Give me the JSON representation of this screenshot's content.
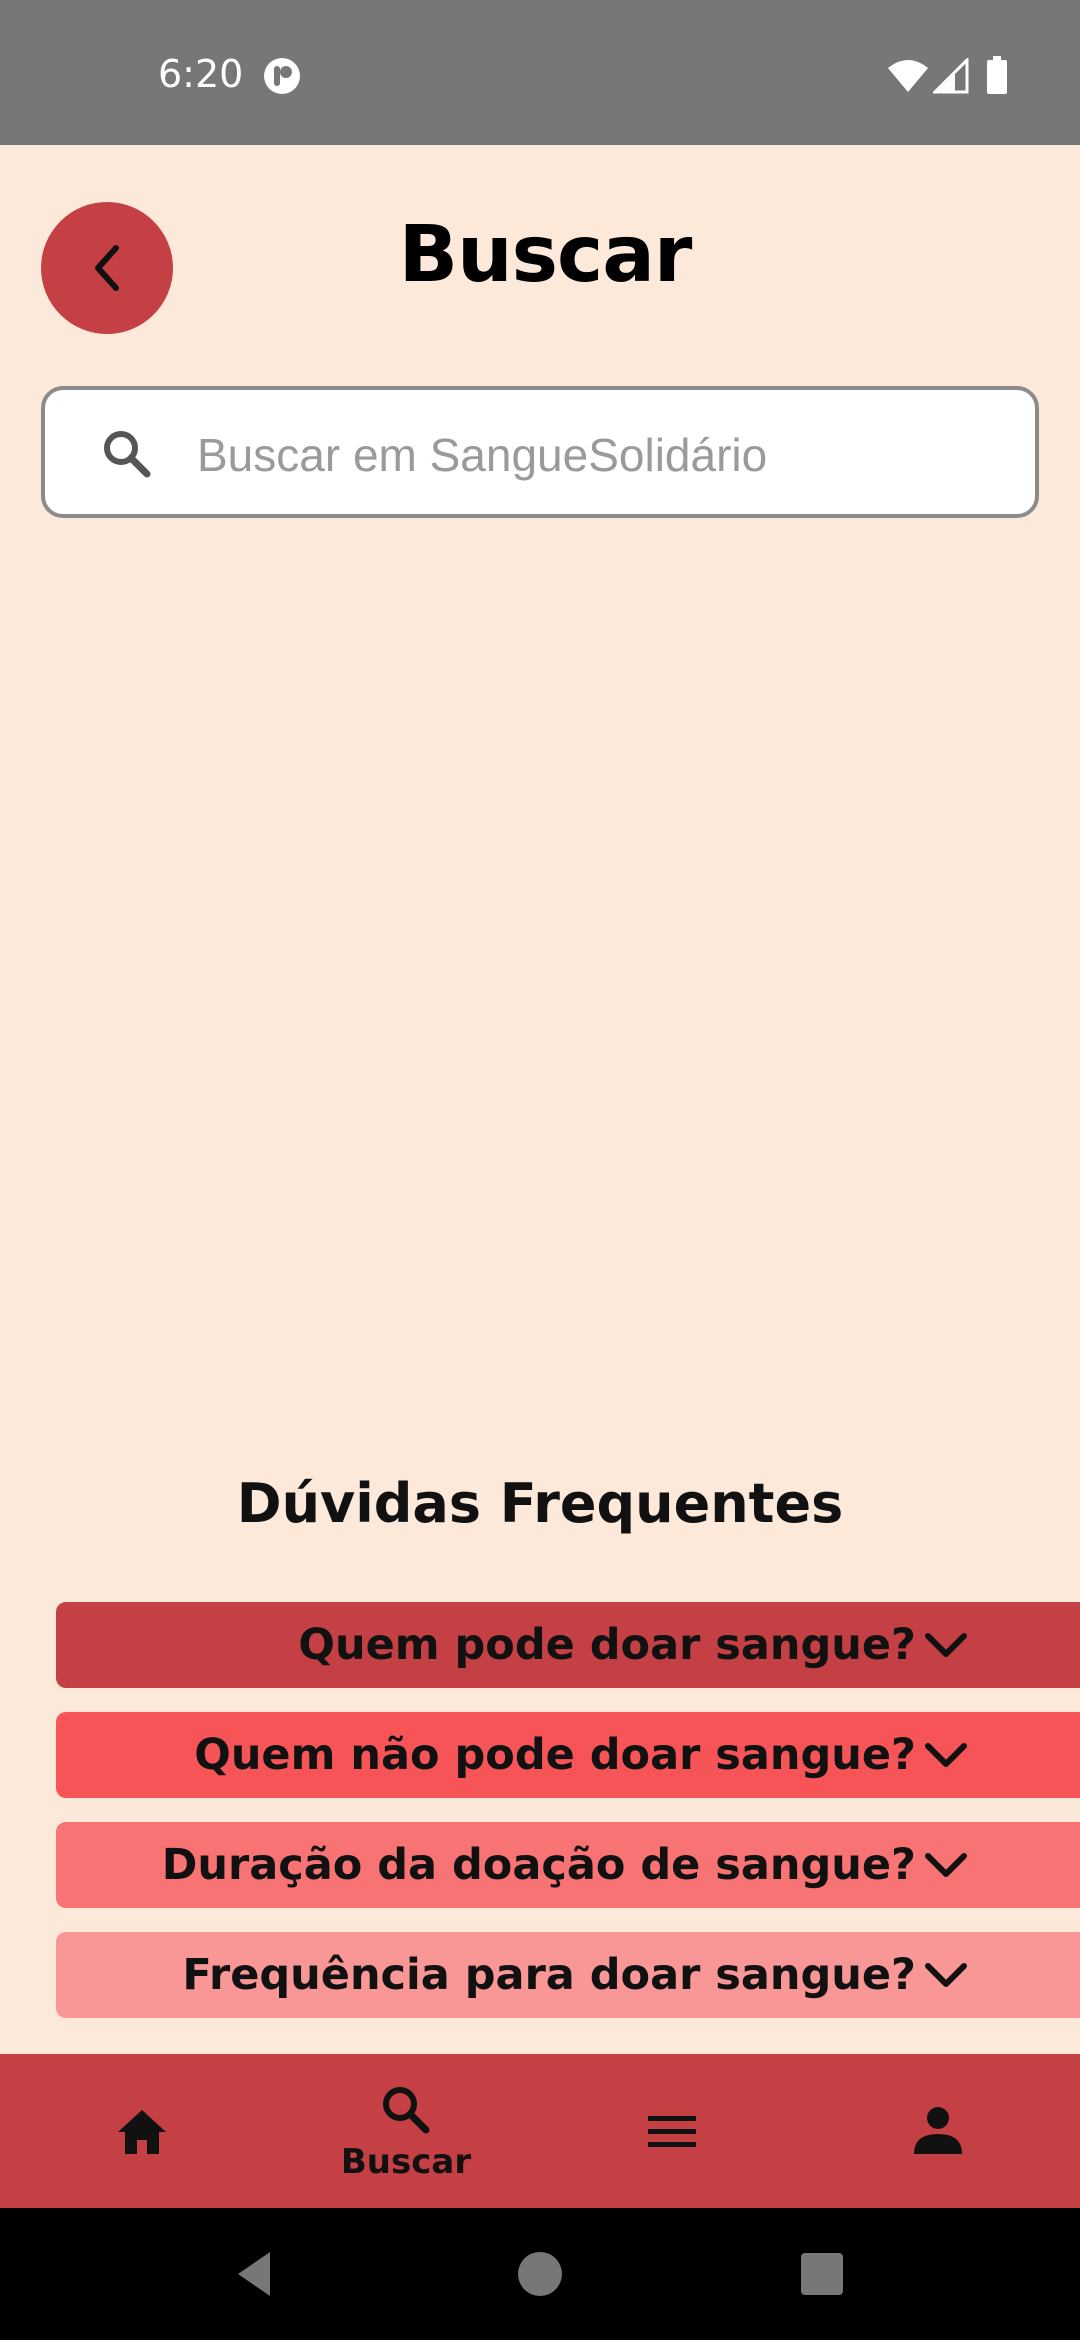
{
  "status_bar": {
    "time": "6:20"
  },
  "header": {
    "title": "Buscar",
    "back_icon": "chevron-left-icon"
  },
  "search": {
    "placeholder": "Buscar em SangueSolidário",
    "value": "",
    "icon": "search-icon"
  },
  "faq": {
    "title": "Dúvidas Frequentes",
    "items": [
      {
        "label": "Quem pode doar sangue?",
        "color": "#C44045"
      },
      {
        "label": "Quem não pode doar sangue?",
        "color": "#F75458"
      },
      {
        "label": "Duração da doação de sangue?",
        "color": "#F87374"
      },
      {
        "label": "Frequência para doar sangue?",
        "color": "#F99696"
      }
    ]
  },
  "bottom_nav": {
    "items": [
      {
        "icon": "home-icon",
        "label": ""
      },
      {
        "icon": "search-icon",
        "label": "Buscar"
      },
      {
        "icon": "menu-icon",
        "label": ""
      },
      {
        "icon": "person-icon",
        "label": ""
      }
    ],
    "active_index": 1
  },
  "colors": {
    "background": "#FDE9DA",
    "primary": "#C44045",
    "status_bar": "#777777"
  }
}
